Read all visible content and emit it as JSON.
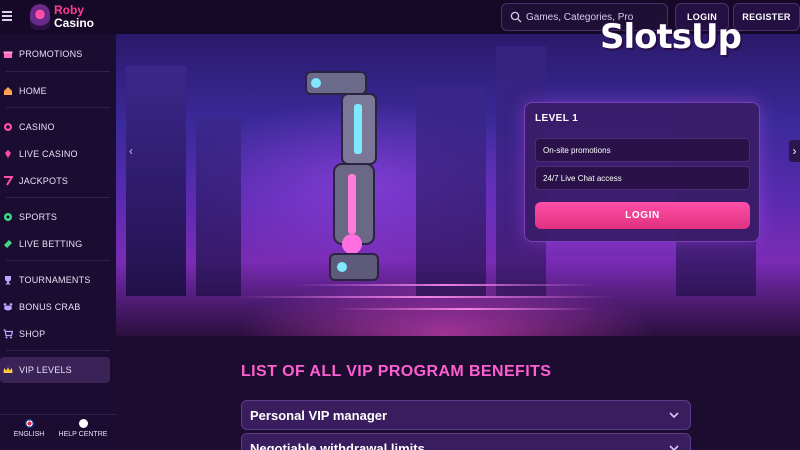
{
  "brand": {
    "logo_line1": "Roby",
    "logo_line2": "Casino"
  },
  "header": {
    "search_placeholder": "Games, Categories, Pro",
    "login_label": "LOGIN",
    "register_label": "REGISTER"
  },
  "watermark": {
    "text": "SlotsUp"
  },
  "sidebar": {
    "items": [
      {
        "label": "PROMOTIONS",
        "icon": "gift-icon"
      },
      {
        "label": "HOME",
        "icon": "home-icon"
      },
      {
        "label": "CASINO",
        "icon": "casino-chip-icon"
      },
      {
        "label": "LIVE CASINO",
        "icon": "live-casino-icon"
      },
      {
        "label": "JACKPOTS",
        "icon": "seven-icon"
      },
      {
        "label": "SPORTS",
        "icon": "ball-icon"
      },
      {
        "label": "LIVE BETTING",
        "icon": "ticket-icon"
      },
      {
        "label": "TOURNAMENTS",
        "icon": "trophy-icon"
      },
      {
        "label": "BONUS CRAB",
        "icon": "crab-icon"
      },
      {
        "label": "SHOP",
        "icon": "cart-icon"
      },
      {
        "label": "VIP LEVELS",
        "icon": "crown-icon"
      }
    ],
    "footer": {
      "language": "ENGLISH",
      "help": "HELP CENTRE"
    }
  },
  "level_card": {
    "title": "LEVEL 1",
    "perks": [
      "On-site promotions",
      "24/7 Live Chat access"
    ],
    "login_label": "LOGIN"
  },
  "content": {
    "section_title": "LIST OF ALL VIP PROGRAM BENEFITS",
    "benefits": [
      "Personal VIP manager",
      "Negotiable withdrawal limits"
    ]
  },
  "colors": {
    "accent_pink": "#ff4fa8",
    "bg": "#1b0c30",
    "title_pink": "#ff5fd0"
  }
}
